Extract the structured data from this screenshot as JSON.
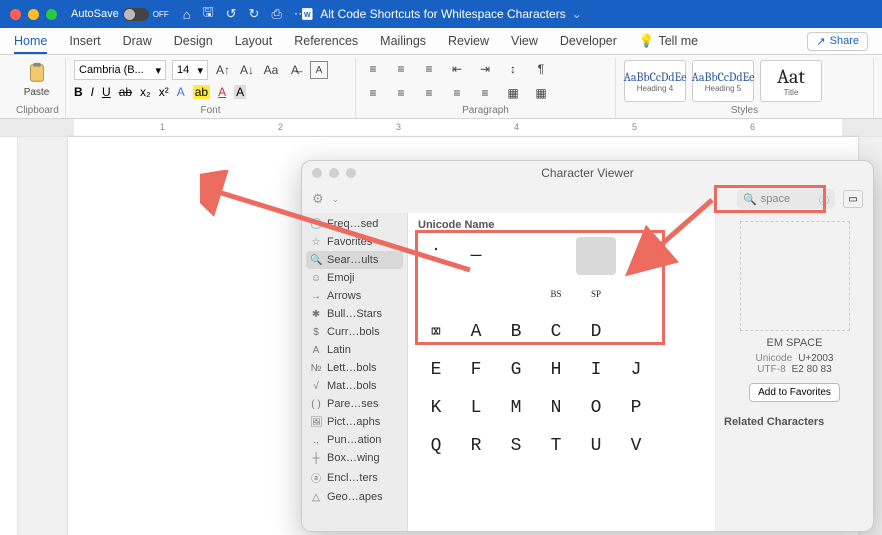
{
  "titlebar": {
    "autosave_label": "AutoSave",
    "autosave_state": "OFF",
    "doc_title": "Alt Code Shortcuts for Whitespace Characters"
  },
  "tabs": [
    "Home",
    "Insert",
    "Draw",
    "Design",
    "Layout",
    "References",
    "Mailings",
    "Review",
    "View",
    "Developer"
  ],
  "tellme": "Tell me",
  "share": "Share",
  "ribbon": {
    "clipboard_label": "Clipboard",
    "paste": "Paste",
    "font_label": "Font",
    "font_name": "Cambria (B...",
    "font_size": "14",
    "paragraph_label": "Paragraph",
    "styles_label": "Styles",
    "styles": [
      {
        "sample": "AaBbCcDdEe",
        "name": "Heading 4"
      },
      {
        "sample": "AaBbCcDdEe",
        "name": "Heading 5"
      },
      {
        "sample": "Aat",
        "name": "Title"
      }
    ]
  },
  "ruler_numbers": [
    "1",
    "2",
    "3",
    "4",
    "5",
    "6"
  ],
  "char_viewer": {
    "title": "Character Viewer",
    "search_value": "space",
    "sidebar": [
      {
        "icon": "🕘",
        "label": "Freq…sed"
      },
      {
        "icon": "☆",
        "label": "Favorites"
      },
      {
        "icon": "🔍",
        "label": "Sear…ults",
        "selected": true
      },
      {
        "icon": "☺",
        "label": "Emoji"
      },
      {
        "icon": "→",
        "label": "Arrows"
      },
      {
        "icon": "✱",
        "label": "Bull…Stars"
      },
      {
        "icon": "$",
        "label": "Curr…bols"
      },
      {
        "icon": "A",
        "label": "Latin"
      },
      {
        "icon": "№",
        "label": "Lett…bols"
      },
      {
        "icon": "√",
        "label": "Mat…bols"
      },
      {
        "icon": "( )",
        "label": "Pare…ses"
      },
      {
        "icon": "🖼",
        "label": "Pict…aphs"
      },
      {
        "icon": ".,",
        "label": "Pun…ation"
      },
      {
        "icon": "┼",
        "label": "Box…wing"
      },
      {
        "icon": "ⓐ",
        "label": "Encl…ters"
      },
      {
        "icon": "△",
        "label": "Geo…apes"
      }
    ],
    "section_header": "Unicode Name",
    "special_row": [
      {
        "g": "⁚"
      },
      {
        "g": "—"
      },
      {
        "g": ""
      },
      {
        "g": ""
      },
      {
        "g": "",
        "sel": true
      }
    ],
    "special_row2": [
      {
        "g": ""
      },
      {
        "g": ""
      },
      {
        "g": ""
      },
      {
        "g": "BS",
        "sm": true
      },
      {
        "g": "SP",
        "sm": true
      }
    ],
    "letter_rows": [
      [
        "⌧",
        "A",
        "B",
        "C",
        "D"
      ],
      [
        "E",
        "F",
        "G",
        "H",
        "I",
        "J"
      ],
      [
        "K",
        "L",
        "M",
        "N",
        "O",
        "P"
      ],
      [
        "Q",
        "R",
        "S",
        "T",
        "U",
        "V"
      ]
    ],
    "detail": {
      "char_name": "EM SPACE",
      "unicode_label": "Unicode",
      "unicode_value": "U+2003",
      "utf8_label": "UTF-8",
      "utf8_value": "E2 80 83",
      "fav_button": "Add to Favorites",
      "related_label": "Related Characters"
    }
  }
}
